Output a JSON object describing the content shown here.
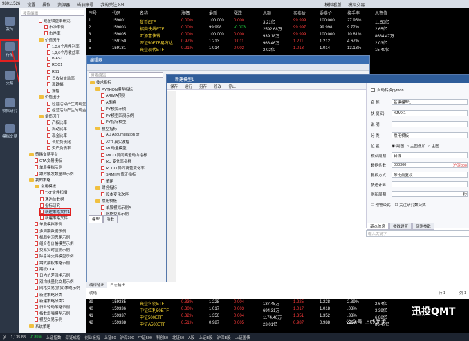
{
  "topbar": {
    "items": [
      "98011526",
      "设置",
      "操作",
      "资源器",
      "当前账号",
      "我的关注 8/8",
      "模拟看版",
      "模拟交易"
    ]
  },
  "leftnav": {
    "items": [
      {
        "label": "我的"
      },
      {
        "label": "行情"
      },
      {
        "label": "交易"
      },
      {
        "label": "模拟研究"
      },
      {
        "label": "模拟交易"
      }
    ]
  },
  "tree": {
    "search_placeholder": "搜索编辑",
    "nodes": [
      "现金收益率研究",
      "市净率倒",
      "市净率",
      "价值因子",
      "1,3,6个月净利率",
      "1,3,6个月收益率",
      "BIAS1",
      "ROC1",
      "RS1",
      "日收益波动率",
      "涨跌幅",
      "振幅",
      "价值因子",
      "经营活动产生的现金",
      "经营活动产生的现金",
      "偿债因子",
      "产权比率",
      "流动比率",
      "现金比率",
      "长期负债比",
      "资产负债率",
      "策略交易平台",
      "CTA交易模板",
      "单股模拟示例",
      "跟时触发数量单示例",
      "我的策略",
      "常用模板",
      "TXT文件扫描",
      "通达信数据",
      "指标研究",
      "新建策略文件1",
      "新建策略文件",
      "单股模拟示例",
      "多周期数据示例",
      "机器学习思路示例",
      "组合看价格模型示例",
      "交易实时监测示例",
      "除息种交得模型示例",
      "跨式期权策略示例",
      "期权CTA",
      "日内价差网格示例",
      "双均线量化交易示例",
      "网格交易(期货)策略示例",
      "新建策略分类",
      "新建策略分类2",
      "行业轮动策略示例",
      "指数增强模型示例",
      "模型交易示例",
      "系统策略"
    ]
  },
  "grid": {
    "headers": [
      "序号",
      "代码",
      "名称",
      "涨幅",
      "最新",
      "涨跌",
      "总额",
      "买卖价",
      "委卖价",
      "换手率",
      "总市值"
    ],
    "rows": [
      [
        "1",
        "159001",
        "货币ETF",
        "0.00%",
        "100.000",
        "0.000",
        "3.21亿",
        "99.999",
        "100.000",
        "27.95%",
        "11.50亿"
      ],
      [
        "2",
        "159003",
        "招商快线ETF",
        "0.00%",
        "99.998",
        "-0.003",
        "2592.68万",
        "99.997",
        "99.998",
        "9.77%",
        "2.65亿"
      ],
      [
        "3",
        "159005",
        "汇添富快钱",
        "0.00%",
        "100.000",
        "0.000",
        "939.18万",
        "99.999",
        "100.000",
        "10.81%",
        "8684.47万"
      ],
      [
        "4",
        "159150",
        "深证50ETF易方达",
        "0.97%",
        "1.213",
        "0.011",
        "968.46万",
        "1.211",
        "1.212",
        "4.67%",
        "2.03亿"
      ],
      [
        "5",
        "159131",
        "央企现代ETF",
        "0.21%",
        "1.014",
        "0.002",
        "2.02亿",
        "1.013",
        "1.014",
        "13.13%",
        "15.40亿"
      ]
    ],
    "bottom_rows": [
      [
        "39",
        "159335",
        "央企科创ETF",
        "0.33%",
        "1.228",
        "0.004",
        "137.45万",
        "1.225",
        "1.228",
        "2.39%",
        "2.64亿"
      ],
      [
        "40",
        "159336",
        "中证红利50ETF",
        "0.30%",
        "1.017",
        "0.003",
        "694.31万",
        "1.017",
        "1.018",
        ".03%",
        "3.39亿"
      ],
      [
        "41",
        "159337",
        "中证500ETF",
        "0.32%",
        "1.350",
        "0.004",
        "1174.46万",
        "1.351",
        "1.352",
        ".33%",
        "6.88亿"
      ],
      [
        "42",
        "159338",
        "中证A500ETF",
        "0.51%",
        "0.987",
        "0.005",
        "23.01亿",
        "0.987",
        "0.988",
        ".51%",
        "86.47亿"
      ]
    ]
  },
  "dialog": {
    "title": "编辑器",
    "search_placeholder": "搜索编辑",
    "tree": [
      "技术指标",
      "PYTHON模型指标",
      "ARIMA预测",
      "A策略",
      "PY模拟示例",
      "PY模型回测示例",
      "PY指标模型",
      "模型指标",
      "AD  Accumulation or",
      "ATR  真实波幅",
      "MI  动量模型",
      "MICD  异同离差动力指标",
      "RC  变化率指标",
      "RCCD  异同离差变化率",
      "SRMI  MI修正指标",
      "策略",
      "财务指标",
      "股本变化次序",
      "常用模板",
      "单股模拟示例A",
      "网格交易示例"
    ],
    "bottom_tabs": [
      "模型",
      "函数"
    ]
  },
  "editor": {
    "title": "新建模型1",
    "tools": [
      "保存",
      "运行",
      "另存",
      "修改",
      "停止"
    ],
    "line_no": "1"
  },
  "props": {
    "checkbox": "自动转换python",
    "fields": [
      {
        "label": "名  称",
        "value": "新建模型1"
      },
      {
        "label": "快 捷 码",
        "value": "XJMX1"
      },
      {
        "label": "说  明",
        "value": ""
      },
      {
        "label": "分  类",
        "value": "常用模板"
      }
    ],
    "position_label": "位  置",
    "position_opts": [
      "副图",
      "主图叠加",
      "主图"
    ],
    "period_label": "默认周期",
    "period_value": "日线",
    "count_label": "数据条数",
    "count_value": "000300",
    "count_right": "沪深300",
    "rights_label": "复权方式",
    "rights_value": "等比前复权",
    "fast_label": "快速计算",
    "refresh_label": "刷新周期",
    "refresh_unit": "秒",
    "check1": "预警公式",
    "check2": "关注研究数公式",
    "tabs": [
      "基本信息",
      "参数设置",
      "回测参数"
    ],
    "input_placeholder": "输入关键字"
  },
  "output": {
    "tabs": [
      "编译输出",
      "日志输出"
    ],
    "row_label": "就绪",
    "row_pos": "行 1",
    "col_pos": "列 1"
  },
  "status": {
    "items": [
      "沪",
      "1,135.83",
      "-0.85%",
      "上证指数",
      "深证成指",
      "创业板指",
      "上证50",
      "沪深300",
      "中证500",
      "科创50",
      "北证50",
      "A股",
      "上证B股",
      "沪深B股",
      "上证国债"
    ]
  },
  "brand": {
    "text": "迅投QMT",
    "sub": "公众号·上线助手"
  }
}
